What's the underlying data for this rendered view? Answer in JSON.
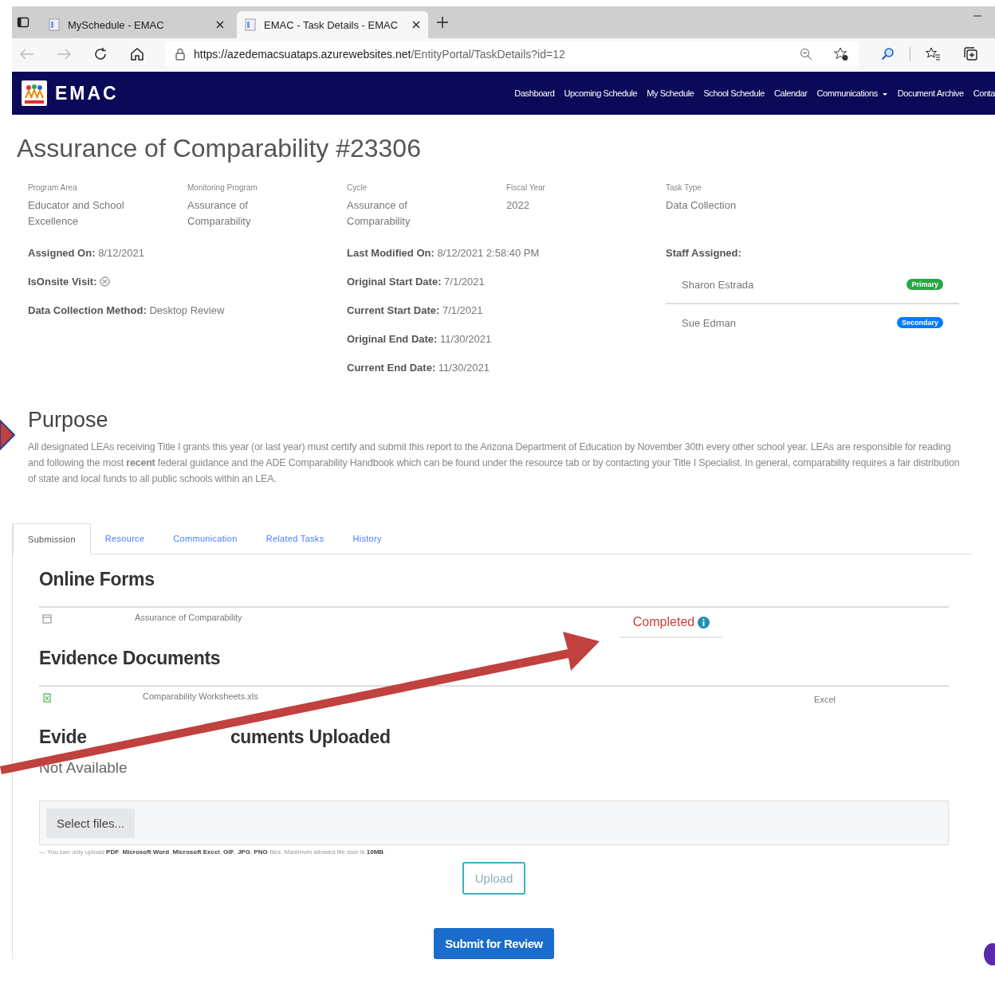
{
  "browser": {
    "tabs": [
      {
        "title": "MySchedule - EMAC",
        "selected": false
      },
      {
        "title": "EMAC - Task Details - EMAC",
        "selected": true
      }
    ],
    "url": {
      "host": "https://azedemacsuataps.azurewebsites.net",
      "path": "/EntityPortal/TaskDetails?id=12"
    }
  },
  "nav": {
    "brand": "EMAC",
    "links": [
      {
        "label": "Dashboard",
        "dropdown": false
      },
      {
        "label": "Upcoming Schedule",
        "dropdown": false
      },
      {
        "label": "My Schedule",
        "dropdown": false
      },
      {
        "label": "School Schedule",
        "dropdown": false
      },
      {
        "label": "Calendar",
        "dropdown": false
      },
      {
        "label": "Communications",
        "dropdown": true
      },
      {
        "label": "Document Archive",
        "dropdown": false
      },
      {
        "label": "Conta",
        "dropdown": false
      }
    ]
  },
  "title": "Assurance of Comparability #23306",
  "fields": [
    {
      "label": "Program Area",
      "value": "Educator and School Excellence"
    },
    {
      "label": "Monitoring Program",
      "value": "Assurance of Comparability"
    },
    {
      "label": "Cycle",
      "value": "Assurance of Comparability"
    },
    {
      "label": "Fiscal Year",
      "value": "2022"
    },
    {
      "label": "Task Type",
      "value": "Data Collection"
    }
  ],
  "details_left": [
    {
      "kind": "text",
      "label": "Assigned On:",
      "value": "8/12/2021"
    },
    {
      "kind": "flag",
      "label": "IsOnsite Visit:",
      "checked": false
    },
    {
      "kind": "text",
      "label": "Data Collection Method:",
      "value": "Desktop Review"
    }
  ],
  "details_mid": [
    {
      "label": "Last Modified On:",
      "value": "8/12/2021 2:58:40 PM"
    },
    {
      "label": "Original Start Date:",
      "value": "7/1/2021"
    },
    {
      "label": "Current Start Date:",
      "value": "7/1/2021"
    },
    {
      "label": "Original End Date:",
      "value": "11/30/2021"
    },
    {
      "label": "Current End Date:",
      "value": "11/30/2021"
    }
  ],
  "staff": {
    "label": "Staff Assigned:",
    "members": [
      {
        "name": "Sharon Estrada",
        "role": "Primary",
        "color": "#28a745"
      },
      {
        "name": "Sue Edman",
        "role": "Secondary",
        "color": "#007bff"
      }
    ]
  },
  "purpose": {
    "heading": "Purpose",
    "text": "All designated LEAs receiving Title I grants this year (or last year) must certify and submit this report to the Arizona Department of Education by November 30th every other school year. LEAs are responsible for reading and following the most **recent** federal guidance and the ADE Comparability Handbook which can be found under the resource tab or by contacting your Title I Specialist. In general, comparability requires a fair distribution of state and local funds to all public schools within an LEA."
  },
  "tabs": [
    {
      "label": "Submission",
      "selected": true
    },
    {
      "label": "Resource",
      "selected": false
    },
    {
      "label": "Communication",
      "selected": false
    },
    {
      "label": "Related Tasks",
      "selected": false
    },
    {
      "label": "History",
      "selected": false
    }
  ],
  "online_forms": {
    "heading": "Online Forms",
    "rows": [
      {
        "name": "Assurance of Comparability",
        "status": "Completed"
      }
    ]
  },
  "evidence": {
    "heading": "Evidence Documents",
    "rows": [
      {
        "name": "Comparability Worksheets.xls",
        "type": "Excel"
      }
    ]
  },
  "uploaded": {
    "heading_parts": [
      "Evide",
      "cuments Uploaded"
    ],
    "value": "Not Available"
  },
  "upload": {
    "select": "Select files...",
    "note": "— You can only upload **PDF**, **Microsoft Word**, **Microsoft Excel**, **GIF**, **JPG**, **PNG** files. Maximum allowed file size is **10MB**.",
    "button": "Upload"
  },
  "submit": "Submit for Review"
}
